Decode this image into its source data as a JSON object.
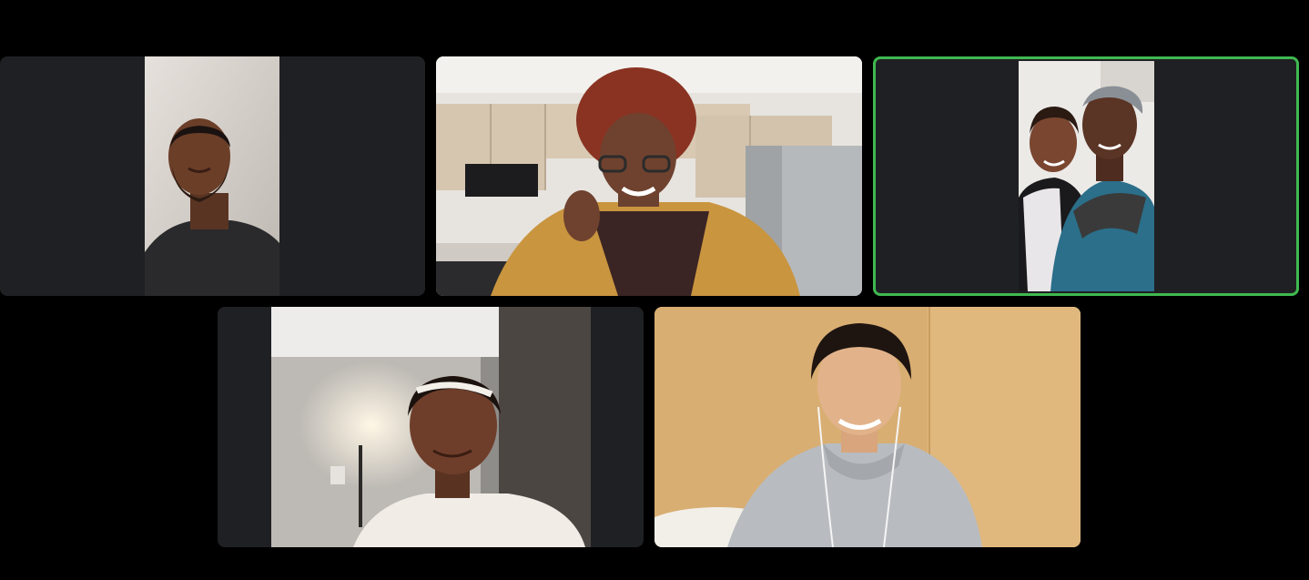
{
  "meeting": {
    "layout": "gallery-view",
    "active_speaker_color": "#3fb950",
    "tile_background": "#1f2023",
    "participants": [
      {
        "feed_icon": "video-feed-man-black-tshirt"
      },
      {
        "feed_icon": "video-feed-woman-glasses-kitchen"
      },
      {
        "feed_icon": "video-feed-father-and-daughter",
        "active_speaker": true
      },
      {
        "feed_icon": "video-feed-woman-headband-lamp"
      },
      {
        "feed_icon": "video-feed-man-grey-hoodie-earphones"
      }
    ]
  }
}
